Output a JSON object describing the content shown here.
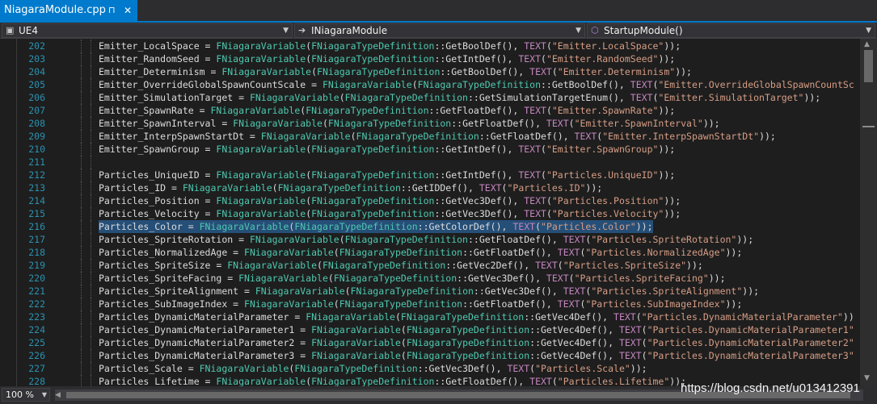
{
  "tab": {
    "title": "NiagaraModule.cpp",
    "pin": "⊓",
    "close": "✕"
  },
  "navbar": {
    "project": "UE4",
    "scope": "INiagaraModule",
    "member": "StartupModule()"
  },
  "zoom": "100 %",
  "watermark": "https://blog.csdn.net/u013412391",
  "colors": {
    "keyword": "#c586c0",
    "type": "#4ec9b0",
    "string": "#d69d85",
    "linenumber": "#2b91af",
    "selection": "#264f78",
    "accent": "#007acc"
  },
  "lines": [
    {
      "n": "202",
      "tokens": [
        [
          "Emitter_LocalSpace = ",
          "p"
        ],
        [
          "FNiagaraVariable",
          "t"
        ],
        [
          "(",
          "p"
        ],
        [
          "FNiagaraTypeDefinition",
          "t"
        ],
        [
          "::GetBoolDef(), ",
          "p"
        ],
        [
          "TEXT",
          "m"
        ],
        [
          "(",
          "p"
        ],
        [
          "\"Emitter.LocalSpace\"",
          "s"
        ],
        [
          "));",
          "p"
        ]
      ]
    },
    {
      "n": "203",
      "tokens": [
        [
          "Emitter_RandomSeed = ",
          "p"
        ],
        [
          "FNiagaraVariable",
          "t"
        ],
        [
          "(",
          "p"
        ],
        [
          "FNiagaraTypeDefinition",
          "t"
        ],
        [
          "::GetIntDef(), ",
          "p"
        ],
        [
          "TEXT",
          "m"
        ],
        [
          "(",
          "p"
        ],
        [
          "\"Emitter.RandomSeed\"",
          "s"
        ],
        [
          "));",
          "p"
        ]
      ]
    },
    {
      "n": "204",
      "tokens": [
        [
          "Emitter_Determinism = ",
          "p"
        ],
        [
          "FNiagaraVariable",
          "t"
        ],
        [
          "(",
          "p"
        ],
        [
          "FNiagaraTypeDefinition",
          "t"
        ],
        [
          "::GetBoolDef(), ",
          "p"
        ],
        [
          "TEXT",
          "m"
        ],
        [
          "(",
          "p"
        ],
        [
          "\"Emitter.Determinism\"",
          "s"
        ],
        [
          "));",
          "p"
        ]
      ]
    },
    {
      "n": "205",
      "tokens": [
        [
          "Emitter_OverrideGlobalSpawnCountScale = ",
          "p"
        ],
        [
          "FNiagaraVariable",
          "t"
        ],
        [
          "(",
          "p"
        ],
        [
          "FNiagaraTypeDefinition",
          "t"
        ],
        [
          "::GetBoolDef(), ",
          "p"
        ],
        [
          "TEXT",
          "m"
        ],
        [
          "(",
          "p"
        ],
        [
          "\"Emitter.OverrideGlobalSpawnCountSc",
          "s"
        ]
      ]
    },
    {
      "n": "206",
      "tokens": [
        [
          "Emitter_SimulationTarget = ",
          "p"
        ],
        [
          "FNiagaraVariable",
          "t"
        ],
        [
          "(",
          "p"
        ],
        [
          "FNiagaraTypeDefinition",
          "t"
        ],
        [
          "::GetSimulationTargetEnum(), ",
          "p"
        ],
        [
          "TEXT",
          "m"
        ],
        [
          "(",
          "p"
        ],
        [
          "\"Emitter.SimulationTarget\"",
          "s"
        ],
        [
          "));",
          "p"
        ]
      ]
    },
    {
      "n": "207",
      "tokens": [
        [
          "Emitter_SpawnRate = ",
          "p"
        ],
        [
          "FNiagaraVariable",
          "t"
        ],
        [
          "(",
          "p"
        ],
        [
          "FNiagaraTypeDefinition",
          "t"
        ],
        [
          "::GetFloatDef(), ",
          "p"
        ],
        [
          "TEXT",
          "m"
        ],
        [
          "(",
          "p"
        ],
        [
          "\"Emitter.SpawnRate\"",
          "s"
        ],
        [
          "));",
          "p"
        ]
      ]
    },
    {
      "n": "208",
      "tokens": [
        [
          "Emitter_SpawnInterval = ",
          "p"
        ],
        [
          "FNiagaraVariable",
          "t"
        ],
        [
          "(",
          "p"
        ],
        [
          "FNiagaraTypeDefinition",
          "t"
        ],
        [
          "::GetFloatDef(), ",
          "p"
        ],
        [
          "TEXT",
          "m"
        ],
        [
          "(",
          "p"
        ],
        [
          "\"Emitter.SpawnInterval\"",
          "s"
        ],
        [
          "));",
          "p"
        ]
      ]
    },
    {
      "n": "209",
      "tokens": [
        [
          "Emitter_InterpSpawnStartDt = ",
          "p"
        ],
        [
          "FNiagaraVariable",
          "t"
        ],
        [
          "(",
          "p"
        ],
        [
          "FNiagaraTypeDefinition",
          "t"
        ],
        [
          "::GetFloatDef(), ",
          "p"
        ],
        [
          "TEXT",
          "m"
        ],
        [
          "(",
          "p"
        ],
        [
          "\"Emitter.InterpSpawnStartDt\"",
          "s"
        ],
        [
          "));",
          "p"
        ]
      ]
    },
    {
      "n": "210",
      "tokens": [
        [
          "Emitter_SpawnGroup = ",
          "p"
        ],
        [
          "FNiagaraVariable",
          "t"
        ],
        [
          "(",
          "p"
        ],
        [
          "FNiagaraTypeDefinition",
          "t"
        ],
        [
          "::GetIntDef(), ",
          "p"
        ],
        [
          "TEXT",
          "m"
        ],
        [
          "(",
          "p"
        ],
        [
          "\"Emitter.SpawnGroup\"",
          "s"
        ],
        [
          "));",
          "p"
        ]
      ]
    },
    {
      "n": "211",
      "tokens": []
    },
    {
      "n": "212",
      "tokens": [
        [
          "Particles_UniqueID = ",
          "p"
        ],
        [
          "FNiagaraVariable",
          "t"
        ],
        [
          "(",
          "p"
        ],
        [
          "FNiagaraTypeDefinition",
          "t"
        ],
        [
          "::GetIntDef(), ",
          "p"
        ],
        [
          "TEXT",
          "m"
        ],
        [
          "(",
          "p"
        ],
        [
          "\"Particles.UniqueID\"",
          "s"
        ],
        [
          "));",
          "p"
        ]
      ]
    },
    {
      "n": "213",
      "tokens": [
        [
          "Particles_ID = ",
          "p"
        ],
        [
          "FNiagaraVariable",
          "t"
        ],
        [
          "(",
          "p"
        ],
        [
          "FNiagaraTypeDefinition",
          "t"
        ],
        [
          "::GetIDDef(), ",
          "p"
        ],
        [
          "TEXT",
          "m"
        ],
        [
          "(",
          "p"
        ],
        [
          "\"Particles.ID\"",
          "s"
        ],
        [
          "));",
          "p"
        ]
      ]
    },
    {
      "n": "214",
      "tokens": [
        [
          "Particles_Position = ",
          "p"
        ],
        [
          "FNiagaraVariable",
          "t"
        ],
        [
          "(",
          "p"
        ],
        [
          "FNiagaraTypeDefinition",
          "t"
        ],
        [
          "::GetVec3Def(), ",
          "p"
        ],
        [
          "TEXT",
          "m"
        ],
        [
          "(",
          "p"
        ],
        [
          "\"Particles.Position\"",
          "s"
        ],
        [
          "));",
          "p"
        ]
      ]
    },
    {
      "n": "215",
      "tokens": [
        [
          "Particles_Velocity = ",
          "p"
        ],
        [
          "FNiagaraVariable",
          "t"
        ],
        [
          "(",
          "p"
        ],
        [
          "FNiagaraTypeDefinition",
          "t"
        ],
        [
          "::GetVec3Def(), ",
          "p"
        ],
        [
          "TEXT",
          "m"
        ],
        [
          "(",
          "p"
        ],
        [
          "\"Particles.Velocity\"",
          "s"
        ],
        [
          "));",
          "p"
        ]
      ]
    },
    {
      "n": "216",
      "selected": true,
      "tokens": [
        [
          "Particles_Color = ",
          "p"
        ],
        [
          "FNiagaraVariable",
          "t"
        ],
        [
          "(",
          "p"
        ],
        [
          "FNiagaraTypeDefinition",
          "t"
        ],
        [
          "::GetColorDef(), ",
          "p"
        ],
        [
          "TEXT",
          "m"
        ],
        [
          "(",
          "p"
        ],
        [
          "\"Particles.Color\"",
          "s"
        ],
        [
          "));",
          "p"
        ]
      ]
    },
    {
      "n": "217",
      "tokens": [
        [
          "Particles_SpriteRotation = ",
          "p"
        ],
        [
          "FNiagaraVariable",
          "t"
        ],
        [
          "(",
          "p"
        ],
        [
          "FNiagaraTypeDefinition",
          "t"
        ],
        [
          "::GetFloatDef(), ",
          "p"
        ],
        [
          "TEXT",
          "m"
        ],
        [
          "(",
          "p"
        ],
        [
          "\"Particles.SpriteRotation\"",
          "s"
        ],
        [
          "));",
          "p"
        ]
      ]
    },
    {
      "n": "218",
      "tokens": [
        [
          "Particles_NormalizedAge = ",
          "p"
        ],
        [
          "FNiagaraVariable",
          "t"
        ],
        [
          "(",
          "p"
        ],
        [
          "FNiagaraTypeDefinition",
          "t"
        ],
        [
          "::GetFloatDef(), ",
          "p"
        ],
        [
          "TEXT",
          "m"
        ],
        [
          "(",
          "p"
        ],
        [
          "\"Particles.NormalizedAge\"",
          "s"
        ],
        [
          "));",
          "p"
        ]
      ]
    },
    {
      "n": "219",
      "tokens": [
        [
          "Particles_SpriteSize = ",
          "p"
        ],
        [
          "FNiagaraVariable",
          "t"
        ],
        [
          "(",
          "p"
        ],
        [
          "FNiagaraTypeDefinition",
          "t"
        ],
        [
          "::GetVec2Def(), ",
          "p"
        ],
        [
          "TEXT",
          "m"
        ],
        [
          "(",
          "p"
        ],
        [
          "\"Particles.SpriteSize\"",
          "s"
        ],
        [
          "));",
          "p"
        ]
      ]
    },
    {
      "n": "220",
      "tokens": [
        [
          "Particles_SpriteFacing = ",
          "p"
        ],
        [
          "FNiagaraVariable",
          "t"
        ],
        [
          "(",
          "p"
        ],
        [
          "FNiagaraTypeDefinition",
          "t"
        ],
        [
          "::GetVec3Def(), ",
          "p"
        ],
        [
          "TEXT",
          "m"
        ],
        [
          "(",
          "p"
        ],
        [
          "\"Particles.SpriteFacing\"",
          "s"
        ],
        [
          "));",
          "p"
        ]
      ]
    },
    {
      "n": "221",
      "tokens": [
        [
          "Particles_SpriteAlignment = ",
          "p"
        ],
        [
          "FNiagaraVariable",
          "t"
        ],
        [
          "(",
          "p"
        ],
        [
          "FNiagaraTypeDefinition",
          "t"
        ],
        [
          "::GetVec3Def(), ",
          "p"
        ],
        [
          "TEXT",
          "m"
        ],
        [
          "(",
          "p"
        ],
        [
          "\"Particles.SpriteAlignment\"",
          "s"
        ],
        [
          "));",
          "p"
        ]
      ]
    },
    {
      "n": "222",
      "tokens": [
        [
          "Particles_SubImageIndex = ",
          "p"
        ],
        [
          "FNiagaraVariable",
          "t"
        ],
        [
          "(",
          "p"
        ],
        [
          "FNiagaraTypeDefinition",
          "t"
        ],
        [
          "::GetFloatDef(), ",
          "p"
        ],
        [
          "TEXT",
          "m"
        ],
        [
          "(",
          "p"
        ],
        [
          "\"Particles.SubImageIndex\"",
          "s"
        ],
        [
          "));",
          "p"
        ]
      ]
    },
    {
      "n": "223",
      "tokens": [
        [
          "Particles_DynamicMaterialParameter = ",
          "p"
        ],
        [
          "FNiagaraVariable",
          "t"
        ],
        [
          "(",
          "p"
        ],
        [
          "FNiagaraTypeDefinition",
          "t"
        ],
        [
          "::GetVec4Def(), ",
          "p"
        ],
        [
          "TEXT",
          "m"
        ],
        [
          "(",
          "p"
        ],
        [
          "\"Particles.DynamicMaterialParameter\"",
          "s"
        ],
        [
          "))",
          "p"
        ]
      ]
    },
    {
      "n": "224",
      "tokens": [
        [
          "Particles_DynamicMaterialParameter1 = ",
          "p"
        ],
        [
          "FNiagaraVariable",
          "t"
        ],
        [
          "(",
          "p"
        ],
        [
          "FNiagaraTypeDefinition",
          "t"
        ],
        [
          "::GetVec4Def(), ",
          "p"
        ],
        [
          "TEXT",
          "m"
        ],
        [
          "(",
          "p"
        ],
        [
          "\"Particles.DynamicMaterialParameter1\"",
          "s"
        ]
      ]
    },
    {
      "n": "225",
      "tokens": [
        [
          "Particles_DynamicMaterialParameter2 = ",
          "p"
        ],
        [
          "FNiagaraVariable",
          "t"
        ],
        [
          "(",
          "p"
        ],
        [
          "FNiagaraTypeDefinition",
          "t"
        ],
        [
          "::GetVec4Def(), ",
          "p"
        ],
        [
          "TEXT",
          "m"
        ],
        [
          "(",
          "p"
        ],
        [
          "\"Particles.DynamicMaterialParameter2\"",
          "s"
        ]
      ]
    },
    {
      "n": "226",
      "tokens": [
        [
          "Particles_DynamicMaterialParameter3 = ",
          "p"
        ],
        [
          "FNiagaraVariable",
          "t"
        ],
        [
          "(",
          "p"
        ],
        [
          "FNiagaraTypeDefinition",
          "t"
        ],
        [
          "::GetVec4Def(), ",
          "p"
        ],
        [
          "TEXT",
          "m"
        ],
        [
          "(",
          "p"
        ],
        [
          "\"Particles.DynamicMaterialParameter3\"",
          "s"
        ]
      ]
    },
    {
      "n": "227",
      "tokens": [
        [
          "Particles_Scale = ",
          "p"
        ],
        [
          "FNiagaraVariable",
          "t"
        ],
        [
          "(",
          "p"
        ],
        [
          "FNiagaraTypeDefinition",
          "t"
        ],
        [
          "::GetVec3Def(), ",
          "p"
        ],
        [
          "TEXT",
          "m"
        ],
        [
          "(",
          "p"
        ],
        [
          "\"Particles.Scale\"",
          "s"
        ],
        [
          "));",
          "p"
        ]
      ]
    },
    {
      "n": "228",
      "tokens": [
        [
          "Particles_Lifetime = ",
          "p"
        ],
        [
          "FNiagaraVariable",
          "t"
        ],
        [
          "(",
          "p"
        ],
        [
          "FNiagaraTypeDefinition",
          "t"
        ],
        [
          "::GetFloatDef(), ",
          "p"
        ],
        [
          "TEXT",
          "m"
        ],
        [
          "(",
          "p"
        ],
        [
          "\"Particles.Lifetime\"",
          "s"
        ],
        [
          "));",
          "p"
        ]
      ]
    }
  ]
}
